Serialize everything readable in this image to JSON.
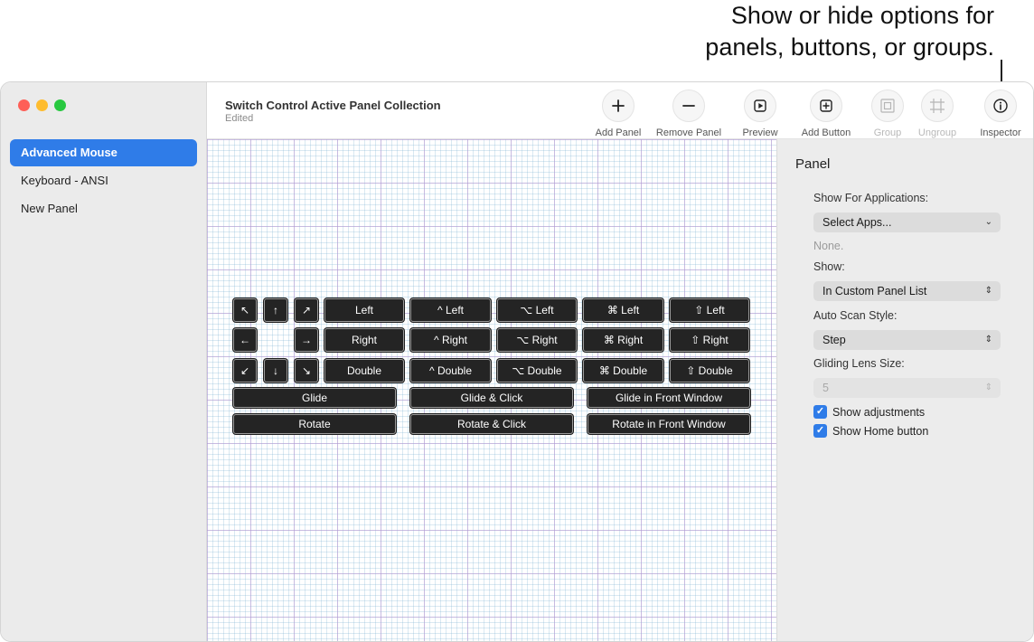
{
  "callout": {
    "line1": "Show or hide options for",
    "line2": "panels, buttons, or groups."
  },
  "sidebar": {
    "items": [
      {
        "label": "Advanced Mouse",
        "selected": true
      },
      {
        "label": "Keyboard - ANSI",
        "selected": false
      },
      {
        "label": "New Panel",
        "selected": false
      }
    ]
  },
  "toolbar": {
    "title": "Switch Control Active Panel Collection",
    "subtitle": "Edited",
    "buttons": [
      {
        "label": "Add Panel",
        "icon": "plus-icon",
        "enabled": true
      },
      {
        "label": "Remove Panel",
        "icon": "minus-icon",
        "enabled": true
      },
      {
        "label": "Preview",
        "icon": "play-icon",
        "enabled": true
      },
      {
        "label": "Add Button",
        "icon": "add-square-icon",
        "enabled": true
      },
      {
        "label": "Group",
        "icon": "group-icon",
        "enabled": false
      },
      {
        "label": "Ungroup",
        "icon": "ungroup-icon",
        "enabled": false
      },
      {
        "label": "Inspector",
        "icon": "info-icon",
        "enabled": true
      }
    ]
  },
  "panel": {
    "arrows": [
      "↖",
      "↑",
      "↗",
      "←",
      "→",
      "↙",
      "↓",
      "↘"
    ],
    "rows": [
      [
        "Left",
        "^ Left",
        "⌥ Left",
        "⌘ Left",
        "⇧ Left"
      ],
      [
        "Right",
        "^ Right",
        "⌥ Right",
        "⌘ Right",
        "⇧ Right"
      ],
      [
        "Double",
        "^ Double",
        "⌥ Double",
        "⌘ Double",
        "⇧ Double"
      ]
    ],
    "wide_rows": [
      [
        "Glide",
        "Glide & Click",
        "Glide in Front Window"
      ],
      [
        "Rotate",
        "Rotate & Click",
        "Rotate in Front Window"
      ]
    ]
  },
  "inspector": {
    "heading": "Panel",
    "show_for_apps_label": "Show For Applications:",
    "select_apps_value": "Select Apps...",
    "none_text": "None.",
    "show_label": "Show:",
    "show_value": "In Custom Panel List",
    "auto_scan_label": "Auto Scan Style:",
    "auto_scan_value": "Step",
    "lens_size_label": "Gliding Lens Size:",
    "lens_size_value": "5",
    "show_adjustments_label": "Show adjustments",
    "show_adjustments_checked": true,
    "show_home_label": "Show Home button",
    "show_home_checked": true
  },
  "colors": {
    "accent": "#2f7ce8",
    "key_background": "#242424",
    "grid_major": "#b996d2",
    "grid_minor": "#78afd2"
  }
}
